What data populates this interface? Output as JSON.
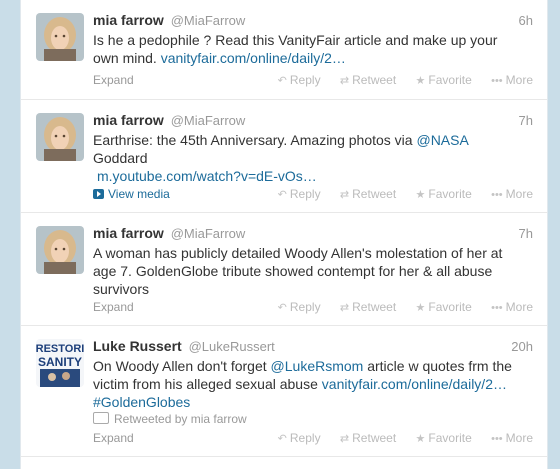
{
  "tweets": [
    {
      "fullname": "mia farrow",
      "username": "@MiaFarrow",
      "time": "6h",
      "text1": "Is he a pedophile ? Read this VanityFair article and make up your",
      "text2": "own mind.",
      "link1": "vanityfair.com/online/daily/2…",
      "footer_left": "Expand"
    },
    {
      "fullname": "mia farrow",
      "username": "@MiaFarrow",
      "time": "7h",
      "text1": "Earthrise: the 45th Anniversary. Amazing photos via",
      "mention": "@NASA",
      "text2": "Goddard",
      "link1": "m.youtube.com/watch?v=dE-vOs…",
      "footer_left": "View media"
    },
    {
      "fullname": "mia farrow",
      "username": "@MiaFarrow",
      "time": "7h",
      "text1": "A woman has publicly detailed Woody Allen's molestation of her at",
      "text2": "age 7. GoldenGlobe tribute showed contempt for her & all abuse",
      "text3": "survivors",
      "footer_left": "Expand"
    },
    {
      "fullname": "Luke Russert",
      "username": "@LukeRussert",
      "time": "20h",
      "text1": "On Woody Allen don't forget",
      "mention": "@LukeRsmom",
      "text1b": "article w quotes frm the",
      "text2": "victim from his alleged sexual abuse",
      "link1": "vanityfair.com/online/daily/2…",
      "hashtag": "#GoldenGlobes",
      "retweeted_by": "Retweeted by mia farrow",
      "footer_left": "Expand",
      "avatar_text1": "RESTORI",
      "avatar_text2": "SANITY"
    }
  ],
  "actions": {
    "reply": "Reply",
    "retweet": "Retweet",
    "favorite": "Favorite",
    "more": "More"
  },
  "colors": {
    "link": "#1c6b9a",
    "background": "#c9dde8"
  }
}
